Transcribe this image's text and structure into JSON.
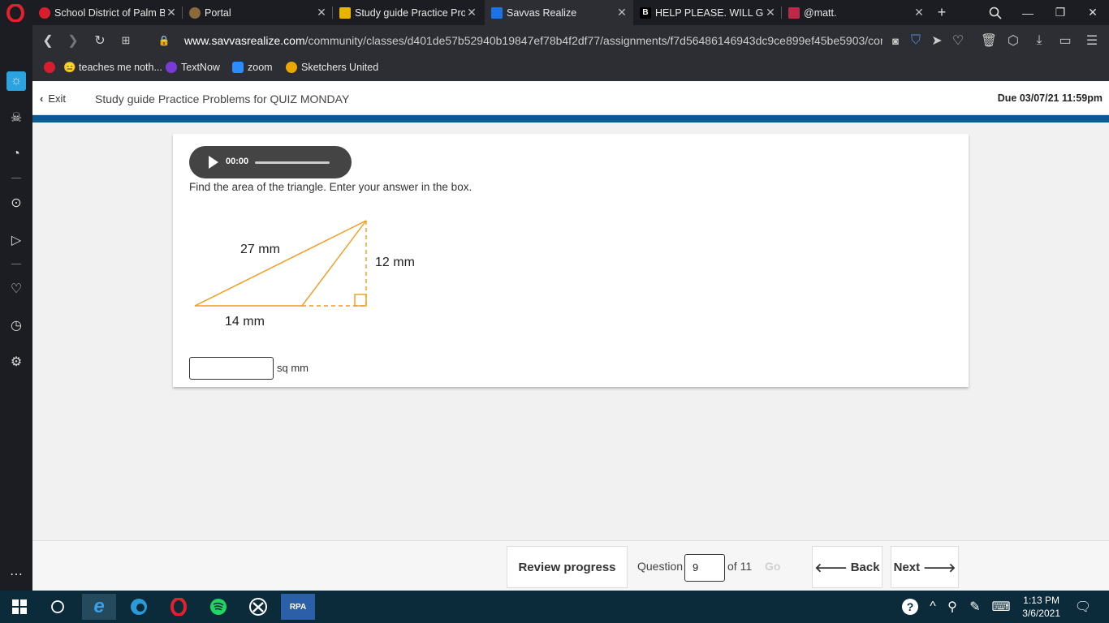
{
  "tabs": [
    {
      "title": "School District of Palm B",
      "color": "#d81e2e"
    },
    {
      "title": "Portal",
      "color": "#8a6a3a"
    },
    {
      "title": "Study guide Practice Pro",
      "color": "#e8b400"
    },
    {
      "title": "Savvas Realize",
      "color": "#1a73e8",
      "active": true
    },
    {
      "title": "HELP PLEASE. WILL GIVE",
      "color": "#000000"
    },
    {
      "title": "@matt.",
      "color": "#c0284a"
    }
  ],
  "url": {
    "host": "www.savvasrealize.com",
    "path": "/community/classes/d401de57b52940b19847ef78b4f2df77/assignments/f7d56486146943dc9ce899ef45be5903/con"
  },
  "bookmarks": [
    {
      "label": "😑 teaches me noth...",
      "color": "#d81e2e"
    },
    {
      "label": "TextNow",
      "color": "#7a3ad8"
    },
    {
      "label": "zoom",
      "color": "#2d8cff"
    },
    {
      "label": "Sketchers United",
      "color": "#e8a800"
    }
  ],
  "header": {
    "exit": "Exit",
    "title": "Study guide Practice Problems for QUIZ MONDAY",
    "due": "Due 03/07/21 11:59pm"
  },
  "question": {
    "audio_time": "00:00",
    "prompt": "Find the area of the triangle. Enter your answer in the box.",
    "label_hyp": "27 mm",
    "label_height": "12 mm",
    "label_base": "14 mm",
    "answer_value": "",
    "unit": "sq mm"
  },
  "footer": {
    "review": "Review progress",
    "question_label": "Question",
    "question_num": "9",
    "of": "of 11",
    "go": "Go",
    "back": "Back",
    "next": "Next"
  },
  "taskbar": {
    "time": "1:13 PM",
    "date": "3/6/2021"
  },
  "colors": {
    "triangle": "#f39a1a",
    "accent_blue": "#0a5a94"
  }
}
